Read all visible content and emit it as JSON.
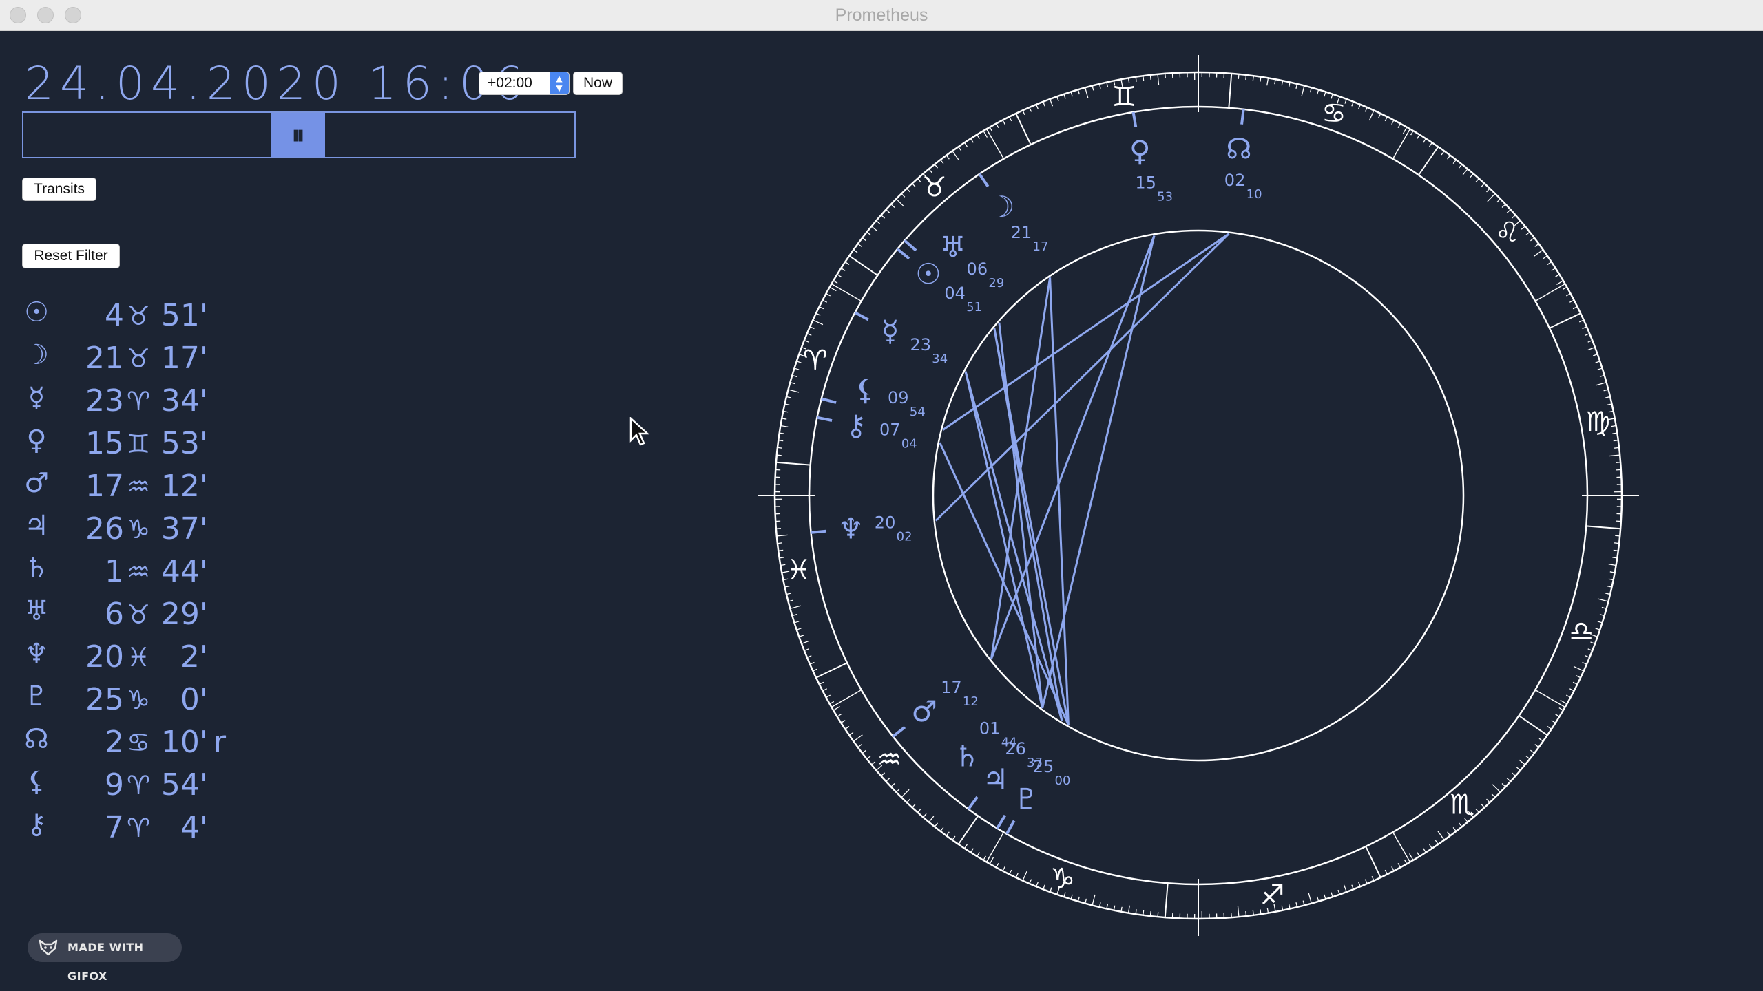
{
  "window": {
    "title": "Prometheus"
  },
  "datetime": {
    "display": "24.04.2020 16:06"
  },
  "timezone": {
    "value": "+02:00"
  },
  "buttons": {
    "now": "Now",
    "transits": "Transits",
    "reset_filter": "Reset Filter"
  },
  "slider": {
    "thumb_glyph": "⏸",
    "position_fraction": 0.5
  },
  "planets": [
    {
      "glyph": "☉",
      "name": "sun",
      "deg": "4",
      "sign": "♉",
      "min": "51'",
      "retro": ""
    },
    {
      "glyph": "☽",
      "name": "moon",
      "deg": "21",
      "sign": "♉",
      "min": "17'",
      "retro": ""
    },
    {
      "glyph": "☿",
      "name": "mercury",
      "deg": "23",
      "sign": "♈",
      "min": "34'",
      "retro": ""
    },
    {
      "glyph": "♀",
      "name": "venus",
      "deg": "15",
      "sign": "♊",
      "min": "53'",
      "retro": ""
    },
    {
      "glyph": "♂",
      "name": "mars",
      "deg": "17",
      "sign": "♒",
      "min": "12'",
      "retro": ""
    },
    {
      "glyph": "♃",
      "name": "jupiter",
      "deg": "26",
      "sign": "♑",
      "min": "37'",
      "retro": ""
    },
    {
      "glyph": "♄",
      "name": "saturn",
      "deg": "1",
      "sign": "♒",
      "min": "44'",
      "retro": ""
    },
    {
      "glyph": "♅",
      "name": "uranus",
      "deg": "6",
      "sign": "♉",
      "min": "29'",
      "retro": ""
    },
    {
      "glyph": "♆",
      "name": "neptune",
      "deg": "20",
      "sign": "♓",
      "min": "2'",
      "retro": ""
    },
    {
      "glyph": "♇",
      "name": "pluto",
      "deg": "25",
      "sign": "♑",
      "min": "0'",
      "retro": ""
    },
    {
      "glyph": "☊",
      "name": "node",
      "deg": "2",
      "sign": "♋",
      "min": "10'",
      "retro": "r"
    },
    {
      "glyph": "⚸",
      "name": "lilith",
      "deg": "9",
      "sign": "♈",
      "min": "54'",
      "retro": ""
    },
    {
      "glyph": "⚷",
      "name": "chiron",
      "deg": "7",
      "sign": "♈",
      "min": "4'",
      "retro": ""
    }
  ],
  "chart_data": {
    "type": "astrology-wheel",
    "ascendant_longitude": 355.5,
    "zodiac": [
      {
        "sign": "♈",
        "start": 0
      },
      {
        "sign": "♉",
        "start": 30
      },
      {
        "sign": "♊",
        "start": 60
      },
      {
        "sign": "♋",
        "start": 90
      },
      {
        "sign": "♌",
        "start": 120
      },
      {
        "sign": "♍",
        "start": 150
      },
      {
        "sign": "♎",
        "start": 180
      },
      {
        "sign": "♏",
        "start": 210
      },
      {
        "sign": "♐",
        "start": 240
      },
      {
        "sign": "♑",
        "start": 270
      },
      {
        "sign": "♒",
        "start": 300
      },
      {
        "sign": "♓",
        "start": 330
      }
    ],
    "bodies": [
      {
        "glyph": "☉",
        "longitude": 34.85,
        "deg": "04",
        "min": "51"
      },
      {
        "glyph": "☽",
        "longitude": 51.28,
        "deg": "21",
        "min": "17"
      },
      {
        "glyph": "☿",
        "longitude": 23.57,
        "deg": "23",
        "min": "34"
      },
      {
        "glyph": "♀",
        "longitude": 75.88,
        "deg": "15",
        "min": "53"
      },
      {
        "glyph": "♂",
        "longitude": 317.2,
        "deg": "17",
        "min": "12"
      },
      {
        "glyph": "♃",
        "longitude": 296.62,
        "deg": "26",
        "min": "37"
      },
      {
        "glyph": "♄",
        "longitude": 301.73,
        "deg": "01",
        "min": "44"
      },
      {
        "glyph": "♅",
        "longitude": 36.48,
        "deg": "06",
        "min": "29"
      },
      {
        "glyph": "♆",
        "longitude": 350.03,
        "deg": "20",
        "min": "02"
      },
      {
        "glyph": "♇",
        "longitude": 295.0,
        "deg": "25",
        "min": "00"
      },
      {
        "glyph": "☊",
        "longitude": 92.17,
        "deg": "02",
        "min": "10"
      },
      {
        "glyph": "⚸",
        "longitude": 9.9,
        "deg": "09",
        "min": "54"
      },
      {
        "glyph": "⚷",
        "longitude": 7.07,
        "deg": "07",
        "min": "04"
      }
    ],
    "aspects": [
      [
        34.85,
        296.62
      ],
      [
        34.85,
        295.0
      ],
      [
        51.28,
        295.0
      ],
      [
        23.57,
        296.62
      ],
      [
        75.88,
        317.2
      ],
      [
        75.88,
        301.73
      ],
      [
        36.48,
        301.73
      ],
      [
        92.17,
        350.03
      ],
      [
        92.17,
        9.9
      ],
      [
        23.57,
        301.73
      ],
      [
        51.28,
        317.2
      ],
      [
        7.07,
        295.0
      ]
    ]
  }
}
